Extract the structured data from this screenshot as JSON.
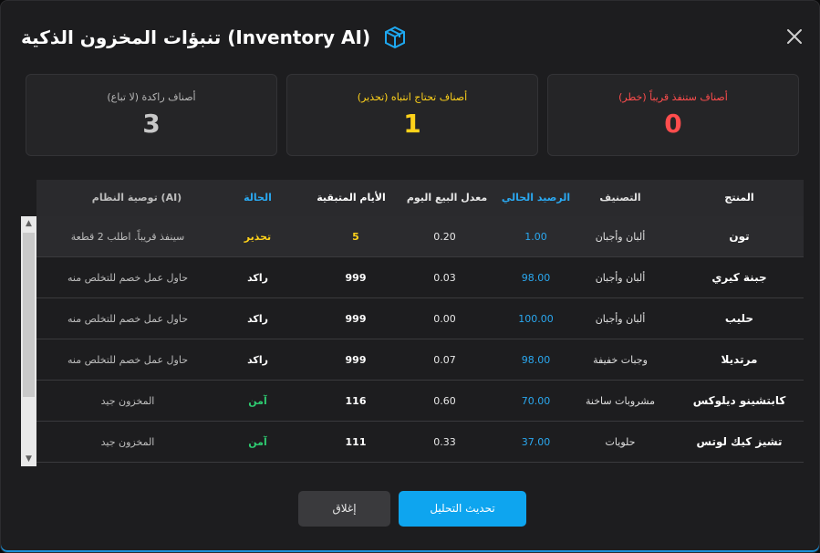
{
  "dialog": {
    "title": "تنبؤات المخزون الذكية (Inventory AI)",
    "title_icon": "package-box-icon",
    "close_icon": "close-icon"
  },
  "cards": [
    {
      "label": "أصناف ستنفذ قريباً (خطر)",
      "value": "0",
      "color": "#ff4d4d"
    },
    {
      "label": "أصناف تحتاج انتباه (تحذير)",
      "value": "1",
      "color": "#ffd21a"
    },
    {
      "label": "أصناف راكدة (لا تباع)",
      "value": "3",
      "color": "#c8c8c8"
    }
  ],
  "table": {
    "headers": {
      "product": "المنتج",
      "category": "التصنيف",
      "balance": "الرصيد الحالي",
      "daily_rate": "معدل البيع اليوم",
      "days_left": "الأيام المتبقية",
      "status": "الحالة",
      "recommendation": "توصية النظام (AI)"
    },
    "rows": [
      {
        "product": "تون",
        "category": "ألبان وأجبان",
        "balance": "1.00",
        "daily_rate": "0.20",
        "days_left": "5",
        "status": "تحذير",
        "recommendation": "سينفذ قريباً. اطلب 2 قطعة"
      },
      {
        "product": "جبنة كيري",
        "category": "ألبان وأجبان",
        "balance": "98.00",
        "daily_rate": "0.03",
        "days_left": "999",
        "status": "راكد",
        "recommendation": "حاول عمل خصم للتخلص منه"
      },
      {
        "product": "حليب",
        "category": "ألبان وأجبان",
        "balance": "100.00",
        "daily_rate": "0.00",
        "days_left": "999",
        "status": "راكد",
        "recommendation": "حاول عمل خصم للتخلص منه"
      },
      {
        "product": "مرتديلا",
        "category": "وجبات خفيفة",
        "balance": "98.00",
        "daily_rate": "0.07",
        "days_left": "999",
        "status": "راكد",
        "recommendation": "حاول عمل خصم للتخلص منه"
      },
      {
        "product": "كابتشينو ديلوكس",
        "category": "مشروبات ساخنة",
        "balance": "70.00",
        "daily_rate": "0.60",
        "days_left": "116",
        "status": "آمن",
        "recommendation": "المخزون جيد"
      },
      {
        "product": "تشيز كيك لوتس",
        "category": "حلويات",
        "balance": "37.00",
        "daily_rate": "0.33",
        "days_left": "111",
        "status": "آمن",
        "recommendation": "المخزون جيد"
      }
    ],
    "status_colors": {
      "تحذير": "#ffd21a",
      "راكد": "#ffffff",
      "آمن": "#2ecc71"
    }
  },
  "buttons": {
    "refresh": "تحديث التحليل",
    "close": "إغلاق"
  }
}
